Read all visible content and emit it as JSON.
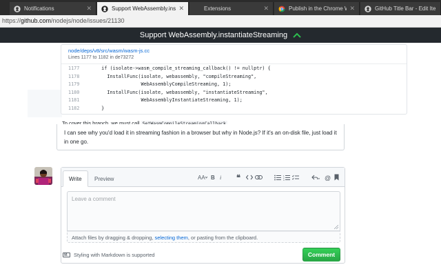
{
  "browser": {
    "tabs": [
      {
        "title": "Notifications",
        "icon": "github-icon"
      },
      {
        "title": "Support WebAssembly.ins",
        "icon": "github-icon",
        "active": true
      },
      {
        "title": "Extensions",
        "icon": "none"
      },
      {
        "title": "Publish in the Chrome Web",
        "icon": "chrome-web-store-icon"
      },
      {
        "title": "GitHub Title Bar - Edit Item",
        "icon": "github-icon"
      }
    ],
    "url_prefix": "https://",
    "url_host": "github.com",
    "url_path": "/nodejs/node/issues/21130"
  },
  "title_bar": {
    "title": "Support WebAssembly.instantiateStreaming",
    "accent_color": "#2cbe4e",
    "background_color": "#24292e"
  },
  "code_snippet": {
    "file_path": "node/deps/v8/src/wasm/wasm-js.cc",
    "lines_prefix": "Lines 1177 to 1182 in",
    "commit_sha": "de73272",
    "rows": [
      {
        "ln": "1177",
        "code": "  if (isolate->wasm_compile_streaming_callback() != nullptr) {"
      },
      {
        "ln": "1178",
        "code": "    InstallFunc(isolate, webassembly, \"compileStreaming\","
      },
      {
        "ln": "1179",
        "code": "                WebAssemblyCompileStreaming, 1);"
      },
      {
        "ln": "1180",
        "code": "    InstallFunc(isolate, webassembly, \"instantiateStreaming\","
      },
      {
        "ln": "1181",
        "code": "                WebAssemblyInstantiateStreaming, 1);"
      },
      {
        "ln": "1182",
        "code": "  }"
      }
    ]
  },
  "cover_line": {
    "text": "To cover this branch, we must call",
    "code": "SetWasmCompileStreamingCallback"
  },
  "comment": {
    "text": "I can see why you'd load it in streaming fashion in a browser but why in Node.js? If it's an on-disk file, just load it in one go."
  },
  "new_comment": {
    "tab_write": "Write",
    "tab_preview": "Preview",
    "toolbar_icons": [
      "text-size-icon",
      "bold-icon",
      "italic-icon",
      "quote-icon",
      "code-icon",
      "link-icon",
      "unordered-list-icon",
      "ordered-list-icon",
      "task-list-icon",
      "reply-icon",
      "mention-icon",
      "bookmark-icon"
    ],
    "placeholder": "Leave a comment",
    "attach_before": "Attach files by dragging & dropping, ",
    "attach_link": "selecting them",
    "attach_after": ", or pasting from the clipboard.",
    "markdown_note": "Styling with Markdown is supported",
    "submit_label": "Comment",
    "submit_color": "#2cbe4e"
  }
}
